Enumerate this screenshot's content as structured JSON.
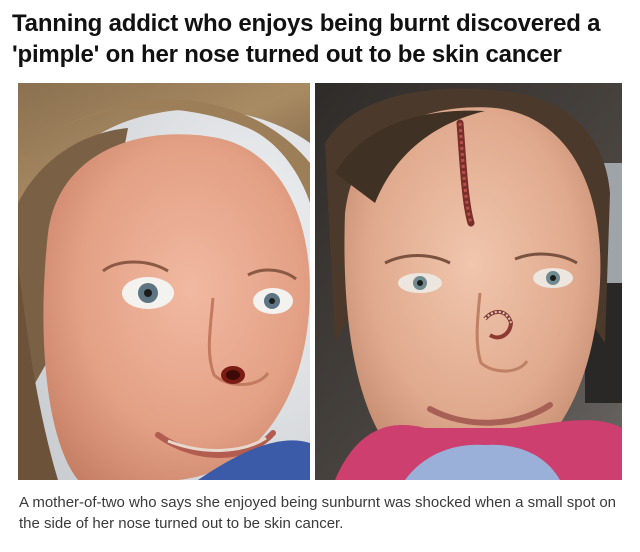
{
  "article": {
    "headline": "Tanning addict who enjoys being burnt discovered a 'pimple' on her nose turned out to be skin cancer",
    "caption": "A mother-of-two who says she enjoyed being sunburnt was shocked when a small spot on the side of her nose turned out to be skin cancer."
  },
  "photos": [
    {
      "label": "before-photo",
      "subject": "woman-smiling-with-nose-lesion"
    },
    {
      "label": "after-photo",
      "subject": "woman-smiling-with-forehead-and-nose-scars"
    }
  ],
  "colors": {
    "headline_text": "#111111",
    "caption_text": "#3a3a3a",
    "background": "#ffffff"
  }
}
